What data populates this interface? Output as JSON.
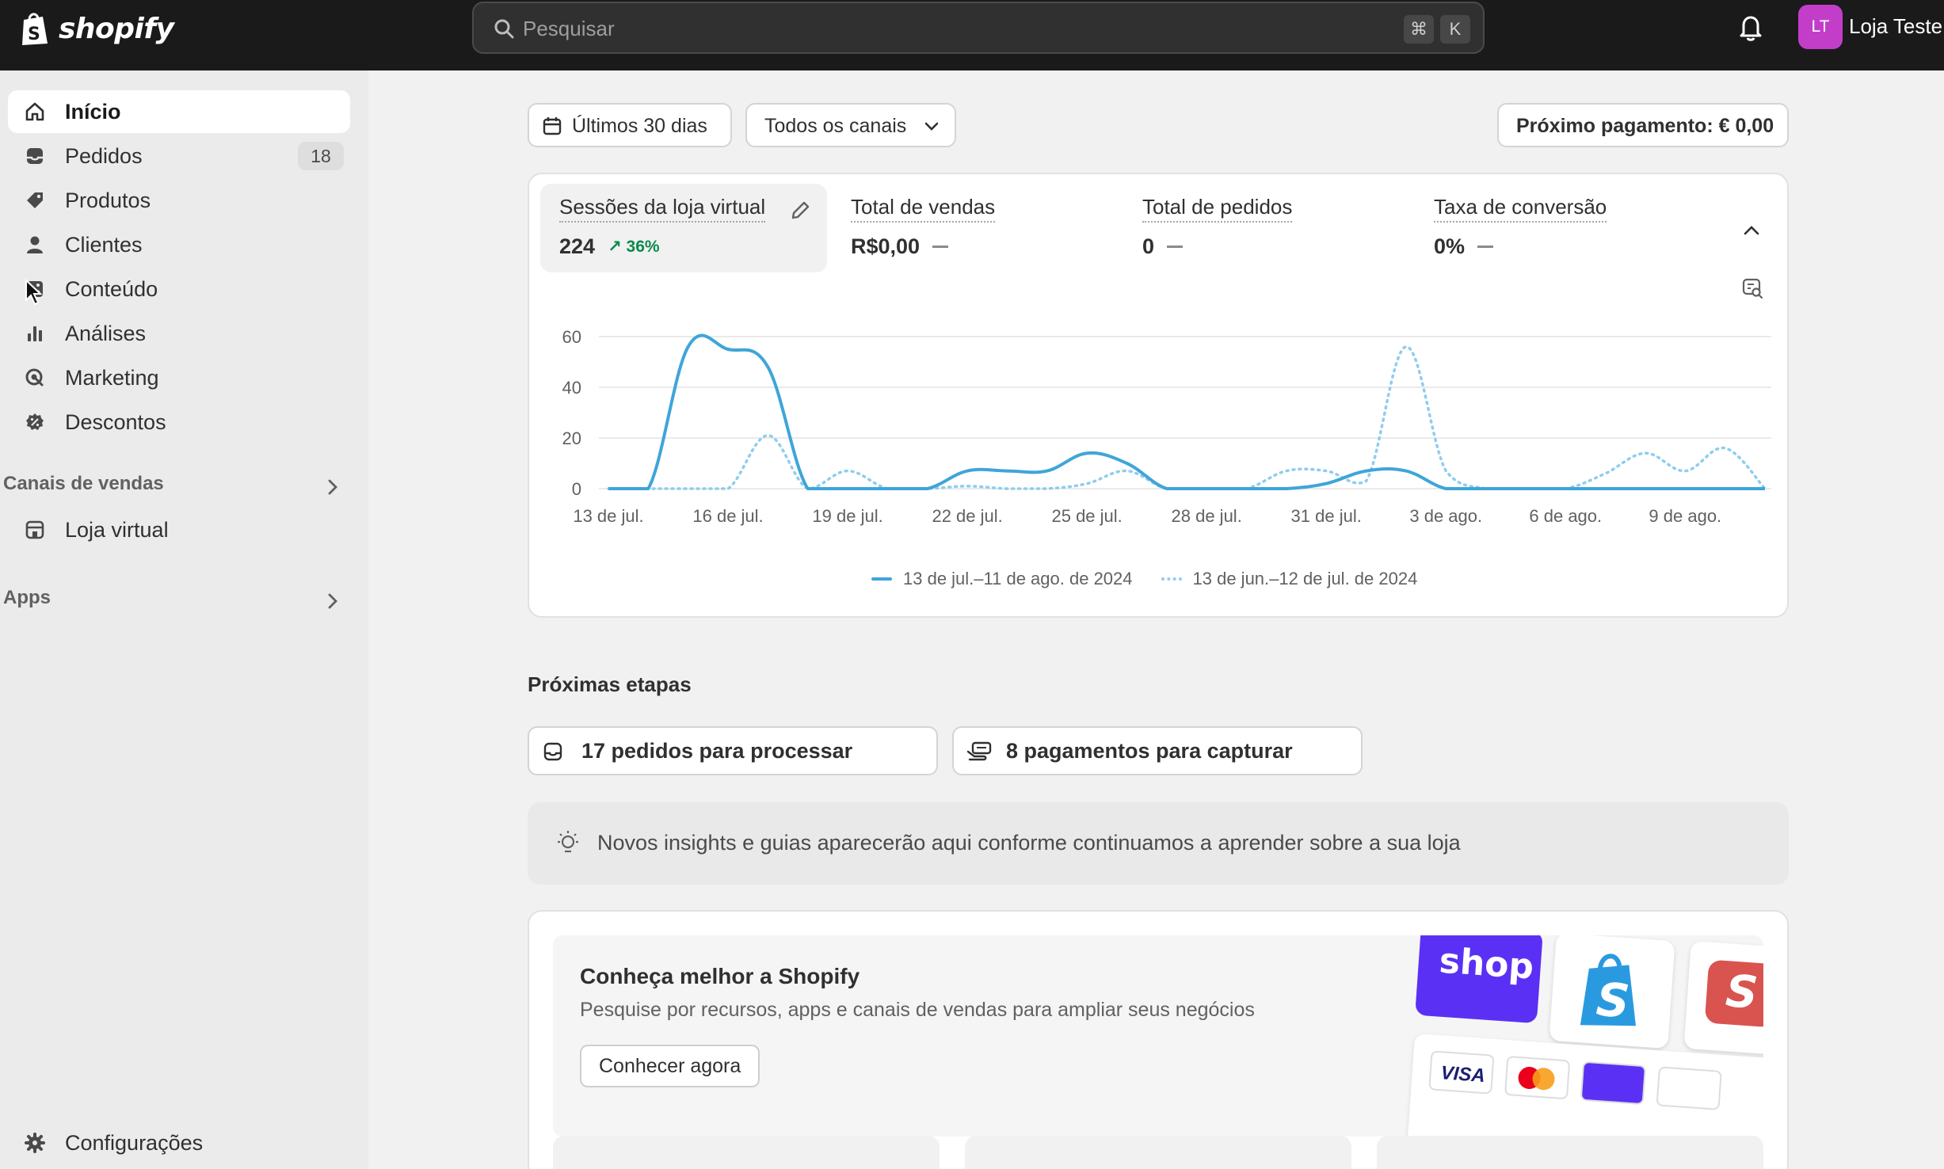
{
  "topbar": {
    "brand": "shopify",
    "search_placeholder": "Pesquisar",
    "shortcut_keys": [
      "⌘",
      "K"
    ],
    "avatar_initials": "LT",
    "store_name": "Loja Teste"
  },
  "sidebar": {
    "items": [
      {
        "label": "Início",
        "icon": "home-icon",
        "active": true
      },
      {
        "label": "Pedidos",
        "icon": "inbox-icon",
        "badge": "18"
      },
      {
        "label": "Produtos",
        "icon": "tag-icon"
      },
      {
        "label": "Clientes",
        "icon": "person-icon"
      },
      {
        "label": "Conteúdo",
        "icon": "image-icon"
      },
      {
        "label": "Análises",
        "icon": "bar-chart-icon"
      },
      {
        "label": "Marketing",
        "icon": "target-icon"
      },
      {
        "label": "Descontos",
        "icon": "discount-icon"
      }
    ],
    "sales_channels_title": "Canais de vendas",
    "sales_channels": [
      {
        "label": "Loja virtual",
        "icon": "store-icon"
      }
    ],
    "apps_title": "Apps",
    "settings_label": "Configurações"
  },
  "filters": {
    "date_range": "Últimos 30 dias",
    "channels": "Todos os canais",
    "next_payment": "Próximo pagamento: € 0,00"
  },
  "metrics": [
    {
      "label": "Sessões da loja virtual",
      "value": "224",
      "delta": "36%",
      "active": true
    },
    {
      "label": "Total de vendas",
      "value": "R$0,00"
    },
    {
      "label": "Total de pedidos",
      "value": "0"
    },
    {
      "label": "Taxa de conversão",
      "value": "0%"
    }
  ],
  "chart_data": {
    "type": "line",
    "x": [
      "13 de jul.",
      "14 de jul.",
      "15 de jul.",
      "16 de jul.",
      "17 de jul.",
      "18 de jul.",
      "19 de jul.",
      "20 de jul.",
      "21 de jul.",
      "22 de jul.",
      "23 de jul.",
      "24 de jul.",
      "25 de jul.",
      "26 de jul.",
      "27 de jul.",
      "28 de jul.",
      "29 de jul.",
      "30 de jul.",
      "31 de jul.",
      "1 de ago.",
      "2 de ago.",
      "3 de ago.",
      "4 de ago.",
      "5 de ago.",
      "6 de ago.",
      "7 de ago.",
      "8 de ago.",
      "9 de ago.",
      "10 de ago.",
      "11 de ago."
    ],
    "tick_labels": [
      "13 de jul.",
      "16 de jul.",
      "19 de jul.",
      "22 de jul.",
      "25 de jul.",
      "28 de jul.",
      "31 de jul.",
      "3 de ago.",
      "6 de ago.",
      "9 de ago."
    ],
    "ylim": [
      0,
      60
    ],
    "yticks": [
      0,
      20,
      40,
      60
    ],
    "grid": true,
    "legend_position": "bottom",
    "series": [
      {
        "name": "13 de jul.–11 de ago. de 2024",
        "style": "solid",
        "color": "#3fa5d9",
        "values": [
          0,
          0,
          56,
          55,
          48,
          0,
          0,
          0,
          0,
          7,
          7,
          7,
          14,
          10,
          0,
          0,
          0,
          0,
          2,
          7,
          7,
          0,
          0,
          0,
          0,
          0,
          0,
          0,
          0,
          0
        ]
      },
      {
        "name": "13 de jun.–12 de jul. de 2024",
        "style": "dotted",
        "color": "#8fcdee",
        "values": [
          0,
          0,
          0,
          0,
          21,
          0,
          7,
          0,
          0,
          1,
          0,
          0,
          2,
          7,
          0,
          0,
          0,
          7,
          7,
          3,
          56,
          7,
          0,
          0,
          0,
          6,
          14,
          7,
          16,
          0
        ]
      }
    ]
  },
  "next_steps": {
    "title": "Próximas etapas",
    "tasks": [
      "17 pedidos para processar",
      "8 pagamentos para capturar"
    ],
    "insight": "Novos insights e guias aparecerão aqui conforme continuamos a aprender sobre a sua loja"
  },
  "promo": {
    "title": "Conheça melhor a Shopify",
    "description": "Pesquise por recursos, apps e canais de vendas para ampliar seus negócios",
    "button": "Conhecer agora",
    "logos": [
      "shop",
      "S",
      "S",
      "VISA"
    ]
  },
  "colors": {
    "accent": "#1a1a1a",
    "success": "#0c8a4b",
    "chart_primary": "#3fa5d9",
    "chart_secondary": "#8fcdee",
    "avatar": "#c23ec9"
  }
}
